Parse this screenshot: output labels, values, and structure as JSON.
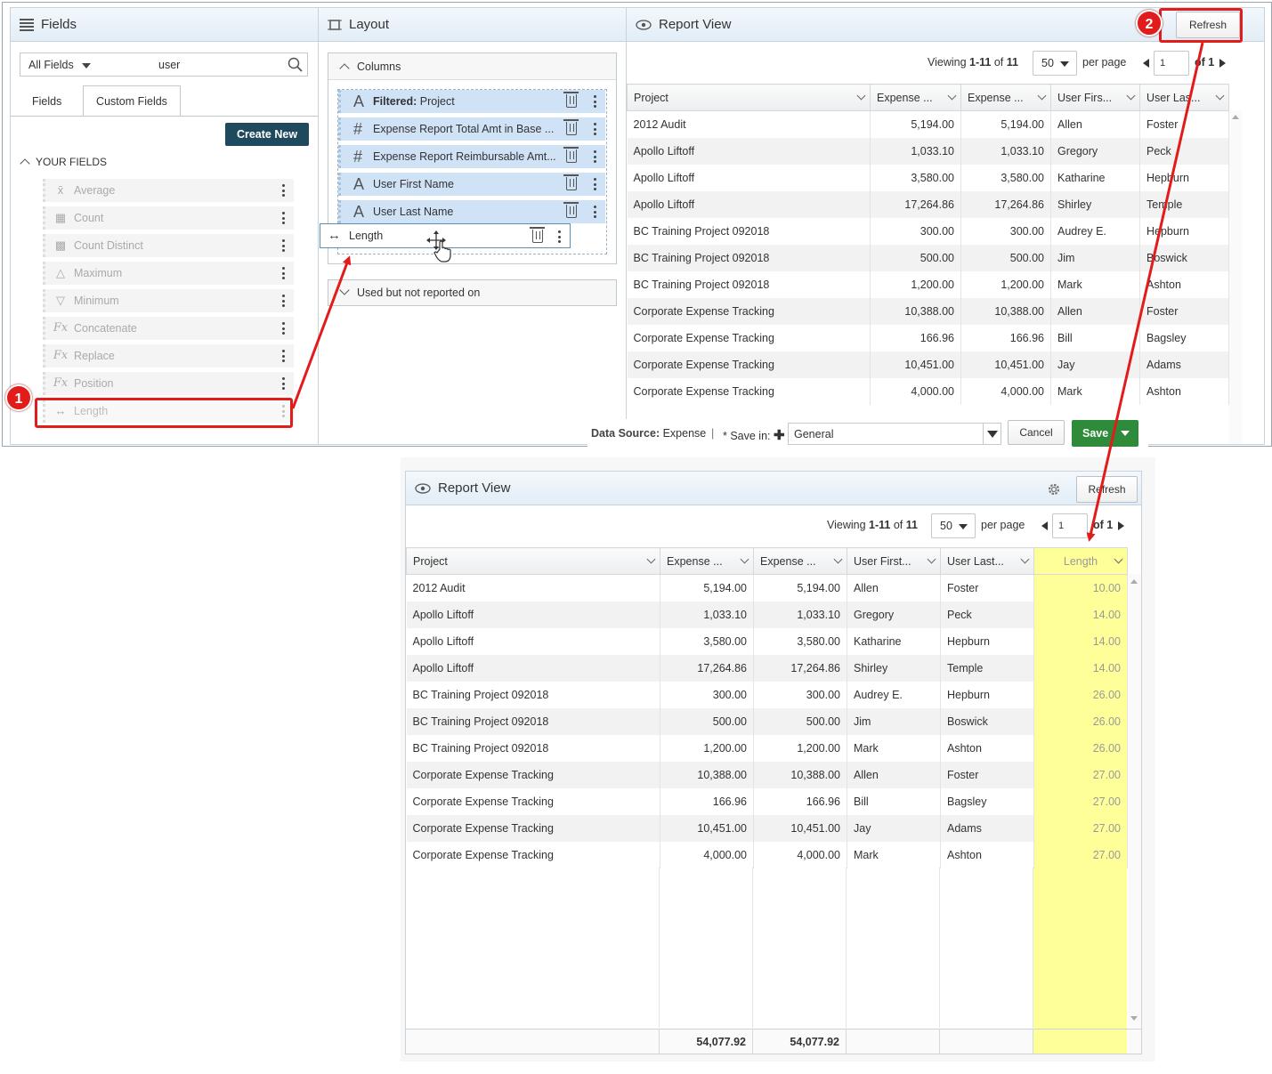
{
  "fields_panel": {
    "title": "Fields",
    "filter_select": "All Fields",
    "search_value": "user",
    "tabs": [
      "Fields",
      "Custom Fields"
    ],
    "create_new": "Create New",
    "section_title": "YOUR FIELDS",
    "items": [
      {
        "label": "Average",
        "icon": "average-icon"
      },
      {
        "label": "Count",
        "icon": "count-icon"
      },
      {
        "label": "Count Distinct",
        "icon": "count-distinct-icon"
      },
      {
        "label": "Maximum",
        "icon": "maximum-icon"
      },
      {
        "label": "Minimum",
        "icon": "minimum-icon"
      },
      {
        "label": "Concatenate",
        "icon": "fx-icon"
      },
      {
        "label": "Replace",
        "icon": "fx-icon"
      },
      {
        "label": "Position",
        "icon": "fx-icon"
      },
      {
        "label": "Length",
        "icon": "length-icon"
      }
    ]
  },
  "layout_panel": {
    "title": "Layout",
    "columns_label": "Columns",
    "columns": [
      {
        "prefix": "Filtered:",
        "label": " Project",
        "icon": "A"
      },
      {
        "prefix": "",
        "label": "Expense Report Total Amt in Base ...",
        "icon": "#"
      },
      {
        "prefix": "",
        "label": "Expense Report Reimbursable Amt...",
        "icon": "#"
      },
      {
        "prefix": "",
        "label": "User First Name",
        "icon": "A"
      },
      {
        "prefix": "",
        "label": "User Last Name",
        "icon": "A"
      }
    ],
    "dragging_item": "Length",
    "used_not_reported": "Used but not reported on"
  },
  "report_top": {
    "title": "Report View",
    "refresh": "Refresh",
    "viewing_prefix": "Viewing ",
    "viewing_range": "1-11",
    "viewing_of": " of ",
    "viewing_total": "11",
    "per_page_value": "50",
    "per_page_label": "per page",
    "page_value": "1",
    "of_pages": "of 1",
    "headers": [
      "Project",
      "Expense ...",
      "Expense ...",
      "User Firs...",
      "User Las..."
    ],
    "rows": [
      [
        "2012 Audit",
        "5,194.00",
        "5,194.00",
        "Allen",
        "Foster"
      ],
      [
        "Apollo Liftoff",
        "1,033.10",
        "1,033.10",
        "Gregory",
        "Peck"
      ],
      [
        "Apollo Liftoff",
        "3,580.00",
        "3,580.00",
        "Katharine",
        "Hepburn"
      ],
      [
        "Apollo Liftoff",
        "17,264.86",
        "17,264.86",
        "Shirley",
        "Temple"
      ],
      [
        "BC Training Project 092018",
        "300.00",
        "300.00",
        "Audrey E.",
        "Hepburn"
      ],
      [
        "BC Training Project 092018",
        "500.00",
        "500.00",
        "Jim",
        "Boswick"
      ],
      [
        "BC Training Project 092018",
        "1,200.00",
        "1,200.00",
        "Mark",
        "Ashton"
      ],
      [
        "Corporate Expense Tracking",
        "10,388.00",
        "10,388.00",
        "Allen",
        "Foster"
      ],
      [
        "Corporate Expense Tracking",
        "166.96",
        "166.96",
        "Bill",
        "Bagsley"
      ],
      [
        "Corporate Expense Tracking",
        "10,451.00",
        "10,451.00",
        "Jay",
        "Adams"
      ],
      [
        "Corporate Expense Tracking",
        "4,000.00",
        "4,000.00",
        "Mark",
        "Ashton"
      ]
    ]
  },
  "footer_bar": {
    "data_source_label": "Data Source:",
    "data_source_value": " Expense",
    "separator": "|",
    "save_in_label": "* Save in:",
    "save_in_value": "General",
    "cancel": "Cancel",
    "save": "Save"
  },
  "report_bottom": {
    "title": "Report View",
    "refresh": "Refresh",
    "viewing_prefix": "Viewing ",
    "viewing_range": "1-11",
    "viewing_of": " of ",
    "viewing_total": "11",
    "per_page_value": "50",
    "per_page_label": "per page",
    "page_value": "1",
    "of_pages": "of 1",
    "headers": [
      "Project",
      "Expense ...",
      "Expense ...",
      "User First...",
      "User Last...",
      "Length"
    ],
    "rows": [
      [
        "2012 Audit",
        "5,194.00",
        "5,194.00",
        "Allen",
        "Foster",
        "10.00"
      ],
      [
        "Apollo Liftoff",
        "1,033.10",
        "1,033.10",
        "Gregory",
        "Peck",
        "14.00"
      ],
      [
        "Apollo Liftoff",
        "3,580.00",
        "3,580.00",
        "Katharine",
        "Hepburn",
        "14.00"
      ],
      [
        "Apollo Liftoff",
        "17,264.86",
        "17,264.86",
        "Shirley",
        "Temple",
        "14.00"
      ],
      [
        "BC Training Project 092018",
        "300.00",
        "300.00",
        "Audrey E.",
        "Hepburn",
        "26.00"
      ],
      [
        "BC Training Project 092018",
        "500.00",
        "500.00",
        "Jim",
        "Boswick",
        "26.00"
      ],
      [
        "BC Training Project 092018",
        "1,200.00",
        "1,200.00",
        "Mark",
        "Ashton",
        "26.00"
      ],
      [
        "Corporate Expense Tracking",
        "10,388.00",
        "10,388.00",
        "Allen",
        "Foster",
        "27.00"
      ],
      [
        "Corporate Expense Tracking",
        "166.96",
        "166.96",
        "Bill",
        "Bagsley",
        "27.00"
      ],
      [
        "Corporate Expense Tracking",
        "10,451.00",
        "10,451.00",
        "Jay",
        "Adams",
        "27.00"
      ],
      [
        "Corporate Expense Tracking",
        "4,000.00",
        "4,000.00",
        "Mark",
        "Ashton",
        "27.00"
      ]
    ],
    "totals": [
      "",
      "54,077.92",
      "54,077.92",
      "",
      "",
      ""
    ]
  },
  "annotations": {
    "step1": "1",
    "step2": "2",
    "color": "#e21b1b"
  },
  "colors": {
    "header_bg": "#e2edf6",
    "highlight": "#ffff99",
    "save_green": "#2e8b3a",
    "create_new": "#1f4a5e"
  }
}
